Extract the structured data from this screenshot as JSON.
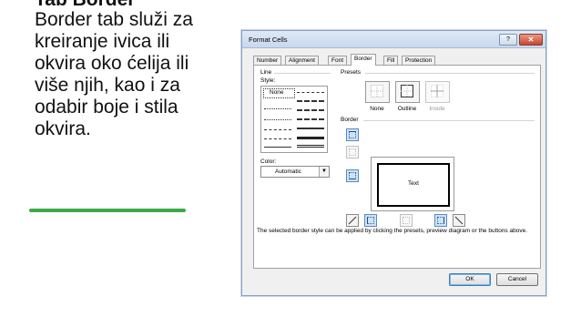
{
  "slide": {
    "title": "Tab Border",
    "body": "Border tab služi za kreiranje ivica ili okvira oko ćelija ili više njih, kao i za odabir boje i stila okvira.",
    "accent_color": "#3daa47"
  },
  "dialog": {
    "title": "Format Cells",
    "help_label": "?",
    "close_label": "✕",
    "tabs": [
      {
        "label": "Number"
      },
      {
        "label": "Alignment"
      },
      {
        "label": "Font"
      },
      {
        "label": "Border"
      },
      {
        "label": "Fill"
      },
      {
        "label": "Protection"
      }
    ],
    "active_tab": "Border",
    "line_group": {
      "label": "Line",
      "style_label": "Style:",
      "none_label": "None",
      "color_label": "Color:",
      "color_value": "Automatic"
    },
    "presets_group": {
      "label": "Presets",
      "items": [
        {
          "label": "None"
        },
        {
          "label": "Outline"
        },
        {
          "label": "Inside"
        }
      ]
    },
    "border_group": {
      "label": "Border",
      "preview_text": "Text"
    },
    "note": "The selected border style can be applied by clicking the presets, preview diagram or the buttons above.",
    "buttons": {
      "ok": "OK",
      "cancel": "Cancel"
    }
  }
}
